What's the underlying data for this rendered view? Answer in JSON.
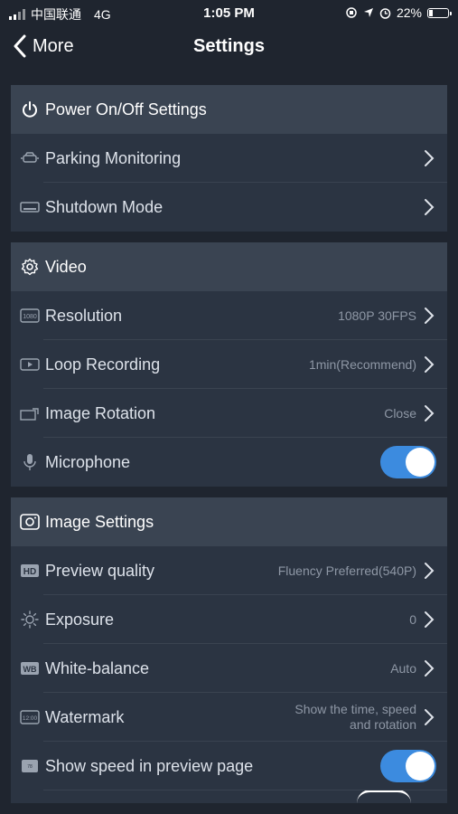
{
  "status_bar": {
    "carrier": "中国联通",
    "network": "4G",
    "time": "1:05 PM",
    "battery_pct": "22%",
    "battery_level": 0.22
  },
  "nav": {
    "back_label": "More",
    "title": "Settings"
  },
  "sections": {
    "power": {
      "title": "Power On/Off Settings",
      "items": {
        "parking": {
          "label": "Parking Monitoring"
        },
        "shutdown": {
          "label": "Shutdown Mode"
        }
      }
    },
    "video": {
      "title": "Video",
      "items": {
        "resolution": {
          "label": "Resolution",
          "value": "1080P 30FPS"
        },
        "loop": {
          "label": "Loop Recording",
          "value": "1min(Recommend)"
        },
        "rotation": {
          "label": "Image Rotation",
          "value": "Close"
        },
        "microphone": {
          "label": "Microphone",
          "on": true
        }
      }
    },
    "image": {
      "title": "Image Settings",
      "items": {
        "preview": {
          "label": "Preview quality",
          "value": "Fluency Preferred(540P)"
        },
        "exposure": {
          "label": "Exposure",
          "value": "0"
        },
        "wb": {
          "label": "White-balance",
          "value": "Auto"
        },
        "watermark": {
          "label": "Watermark",
          "value_line1": "Show the time, speed",
          "value_line2": "and rotation"
        },
        "speed": {
          "label": "Show speed in preview page",
          "on": true
        }
      }
    }
  },
  "colors": {
    "background": "#1f252f",
    "section_bg": "#2b3442",
    "header_bg": "#3a4452",
    "toggle_on": "#3c8bdf"
  }
}
